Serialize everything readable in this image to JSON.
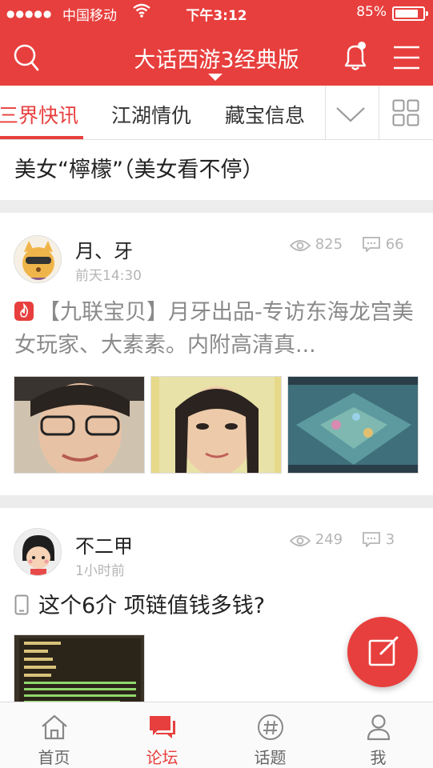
{
  "status_bar": {
    "dots": "●●●●●",
    "carrier": "中国移动",
    "time": "下午3:12",
    "battery": "85%"
  },
  "header": {
    "title": "大话西游3经典版"
  },
  "tabs": [
    {
      "label": "三界快讯",
      "active": true
    },
    {
      "label": "江湖情仇",
      "active": false
    },
    {
      "label": "藏宝信息",
      "active": false
    }
  ],
  "feed": {
    "partial_post_title": "美女“檸檬”（美女看不停）",
    "posts": [
      {
        "author": "月、牙",
        "time": "前天14:30",
        "views": "825",
        "comments": "66",
        "title": "【九联宝贝】月牙出品-专访东海龙宫美女玩家、大素素。内附高清真..."
      },
      {
        "author": "不二甲",
        "time": "1小时前",
        "views": "249",
        "comments": "3",
        "title": "这个6介 项链值钱多钱?"
      }
    ]
  },
  "tab_bar": [
    {
      "label": "首页",
      "icon": "home-icon",
      "active": false
    },
    {
      "label": "论坛",
      "icon": "forum-icon",
      "active": true
    },
    {
      "label": "话题",
      "icon": "hashtag-icon",
      "active": false
    },
    {
      "label": "我",
      "icon": "person-icon",
      "active": false
    }
  ],
  "colors": {
    "accent": "#e73f3d",
    "muted": "#b5b5b5",
    "divider": "#ececec"
  }
}
